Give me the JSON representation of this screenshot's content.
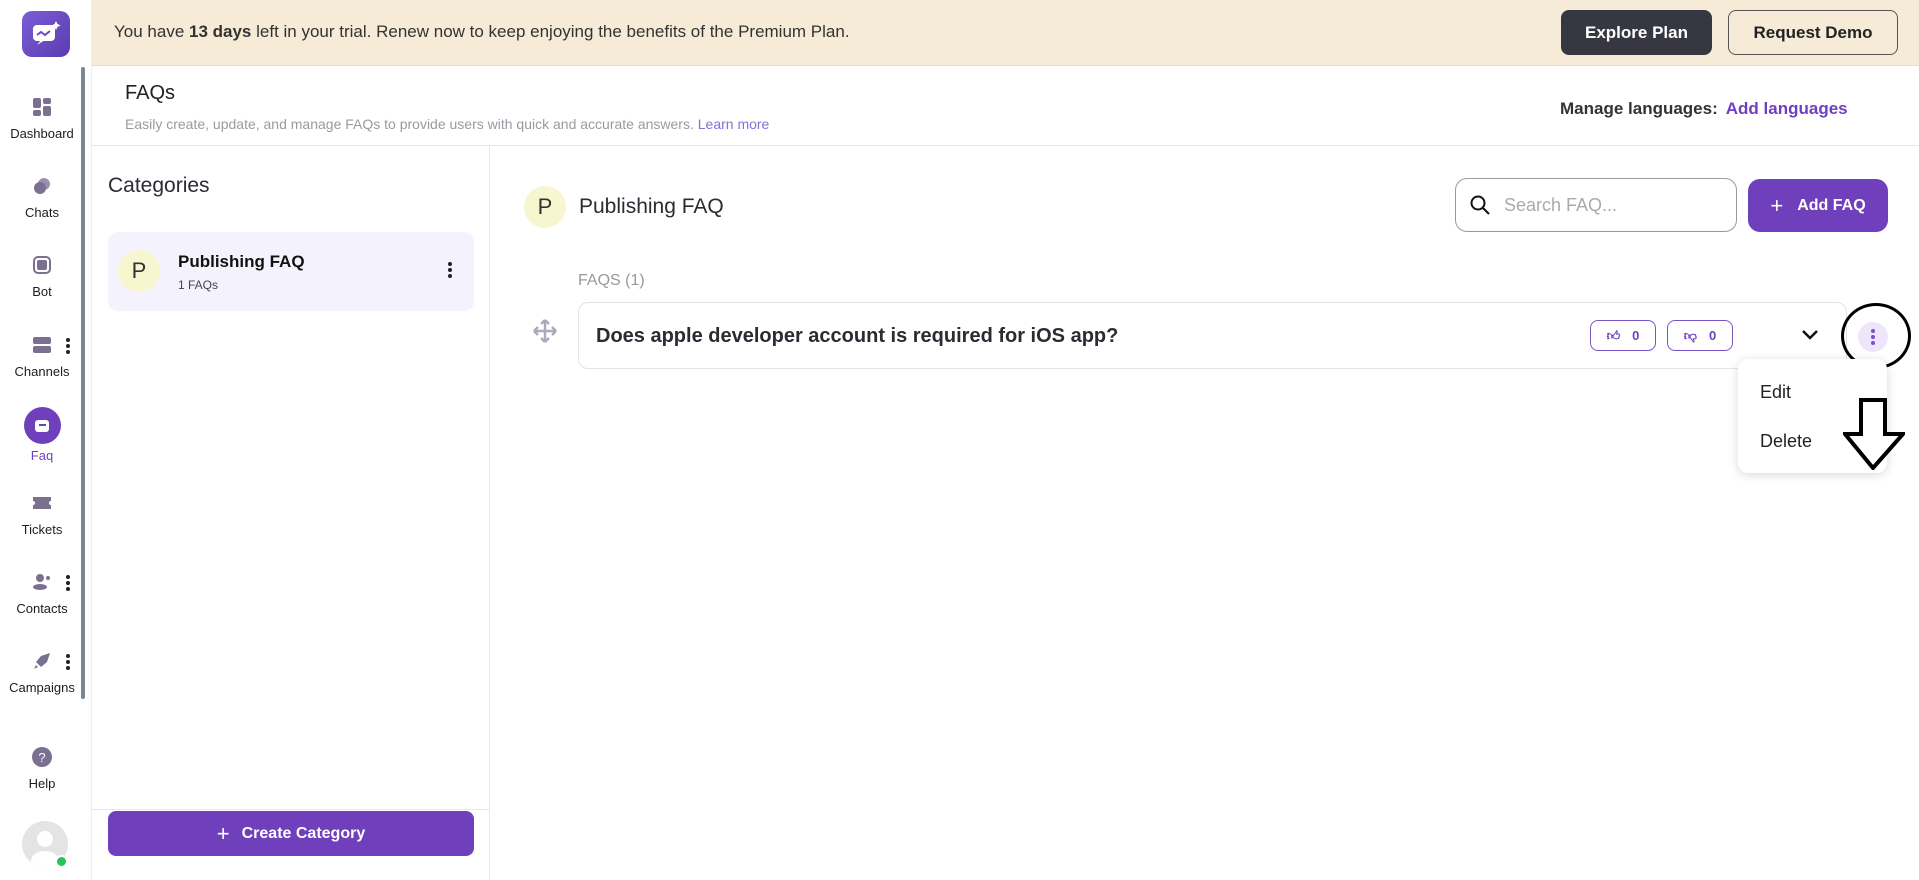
{
  "banner": {
    "text_before": "You have ",
    "days": "13 days",
    "text_after": " left in your trial. Renew now to keep enjoying the benefits of the Premium Plan.",
    "explore_label": "Explore Plan",
    "demo_label": "Request Demo"
  },
  "sidebar": {
    "items": [
      {
        "label": "Dashboard",
        "icon": "dashboard-icon"
      },
      {
        "label": "Chats",
        "icon": "chats-icon"
      },
      {
        "label": "Bot",
        "icon": "bot-icon"
      },
      {
        "label": "Channels",
        "icon": "channels-icon"
      },
      {
        "label": "Faq",
        "icon": "faq-icon",
        "active": true
      },
      {
        "label": "Tickets",
        "icon": "tickets-icon"
      },
      {
        "label": "Contacts",
        "icon": "contacts-icon"
      },
      {
        "label": "Campaigns",
        "icon": "campaigns-icon"
      },
      {
        "label": "Help",
        "icon": "help-icon"
      }
    ]
  },
  "header": {
    "title": "FAQs",
    "subtitle": "Easily create, update, and manage FAQs to provide users with quick and accurate answers.",
    "learn_more": "Learn more",
    "manage_languages": "Manage languages:",
    "add_languages": "Add languages"
  },
  "categories": {
    "title": "Categories",
    "items": [
      {
        "initial": "P",
        "name": "Publishing FAQ",
        "count": "1 FAQs"
      }
    ],
    "create_label": "Create Category"
  },
  "main": {
    "initial": "P",
    "title": "Publishing FAQ",
    "search_placeholder": "Search FAQ...",
    "add_label": "Add FAQ",
    "faqs_label": "FAQS (1)",
    "faqs": [
      {
        "question": "Does apple developer account is required for iOS app?",
        "likes": "0",
        "dislikes": "0"
      }
    ],
    "menu": [
      "Edit",
      "Delete"
    ]
  },
  "colors": {
    "accent": "#6f3fbc",
    "banner": "#f5ebd6"
  }
}
